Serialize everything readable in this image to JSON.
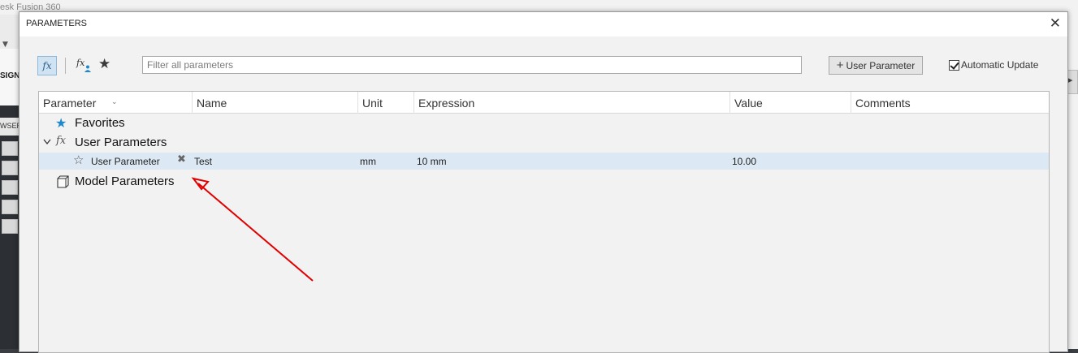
{
  "background": {
    "app_title": "esk Fusion 360",
    "ribbon_label": "SIGN",
    "browser_label": "WSER"
  },
  "dialog": {
    "title": "PARAMETERS",
    "close_glyph": "✕",
    "toolbar": {
      "filter_placeholder": "Filter all parameters",
      "filter_value": "",
      "add_button_label": "User Parameter",
      "auto_update_label": "Automatic Update",
      "auto_update_checked": true
    },
    "columns": [
      "Parameter",
      "Name",
      "Unit",
      "Expression",
      "Value",
      "Comments"
    ],
    "tree": {
      "favorites_label": "Favorites",
      "user_parameters_label": "User Parameters",
      "model_parameters_label": "Model Parameters"
    },
    "rows": [
      {
        "parameter": "User Parameter",
        "name": "Test",
        "unit": "mm",
        "expression": "10 mm",
        "value": "10.00",
        "comments": ""
      }
    ]
  },
  "colors": {
    "accent": "#1e88c8",
    "selected_row": "#dce9f5",
    "annotation_arrow": "#e00000"
  }
}
